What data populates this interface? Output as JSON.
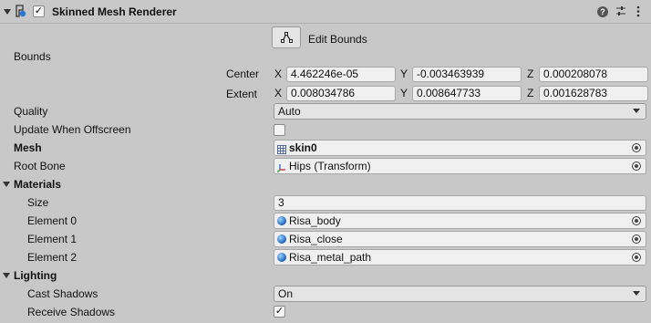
{
  "component": {
    "title": "Skinned Mesh Renderer",
    "enabled": true,
    "icons": [
      "renderer-icon",
      "help-icon",
      "preset-icon",
      "kebab-menu-icon"
    ]
  },
  "edit_bounds": {
    "label": "Edit Bounds",
    "icon": "edit-bounds-icon"
  },
  "bounds": {
    "label": "Bounds",
    "center": {
      "label": "Center",
      "x": "4.462246e-05",
      "y": "-0.003463939",
      "z": "0.000208078"
    },
    "extent": {
      "label": "Extent",
      "x": "0.008034786",
      "y": "0.008647733",
      "z": "0.001628783"
    },
    "axes": {
      "x": "X",
      "y": "Y",
      "z": "Z"
    }
  },
  "quality": {
    "label": "Quality",
    "value": "Auto"
  },
  "update_offscreen": {
    "label": "Update When Offscreen",
    "checked": false
  },
  "mesh": {
    "label": "Mesh",
    "value": "skin0",
    "icon": "mesh-grid-icon"
  },
  "root_bone": {
    "label": "Root Bone",
    "value": "Hips (Transform)",
    "icon": "transform-icon"
  },
  "materials": {
    "label": "Materials",
    "size": {
      "label": "Size",
      "value": "3"
    },
    "elements": [
      {
        "label": "Element 0",
        "value": "Risa_body"
      },
      {
        "label": "Element 1",
        "value": "Risa_close"
      },
      {
        "label": "Element 2",
        "value": "Risa_metal_path"
      }
    ]
  },
  "lighting": {
    "label": "Lighting",
    "cast_shadows": {
      "label": "Cast Shadows",
      "value": "On"
    },
    "receive_shadows": {
      "label": "Receive Shadows",
      "checked": true,
      "mark": "✓"
    }
  },
  "colors": {
    "panel": "#c8c8c8",
    "field": "#f0f0f0",
    "header": "#cbcbcb",
    "accent": "#1a62b8"
  }
}
